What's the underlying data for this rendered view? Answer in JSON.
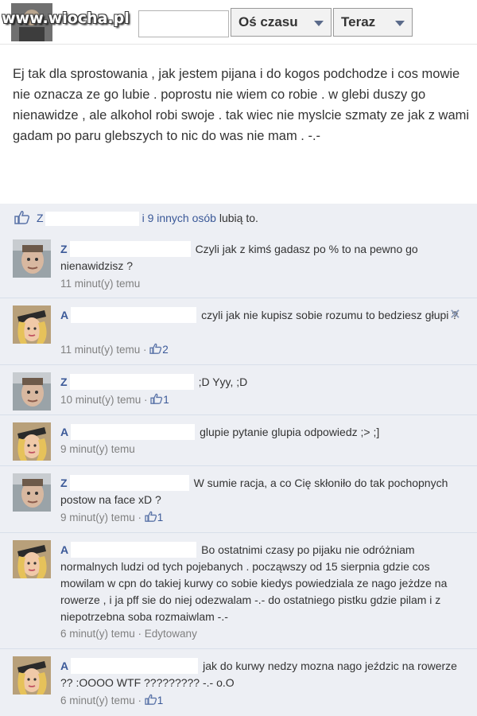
{
  "watermark": "www.wiocha.pl",
  "header": {
    "filter1": "Oś czasu",
    "filter2": "Teraz"
  },
  "post": {
    "text": "Ej tak dla sprostowania , jak jestem pijana i do kogos podchodze i cos mowie nie oznacza ze go lubie . poprostu nie wiem co robie . w glebi duszy go nienawidze , ale alkohol robi swoje . tak wiec nie myslcie szmaty ze jak z wami gadam po paru glebszych to nic do was nie mam . -.-"
  },
  "likes": {
    "first_initial": "Z",
    "others": "i 9 innych osób",
    "suffix": "lubią to."
  },
  "comments": [
    {
      "author": "Z",
      "text": "Czyli jak z kimś gadasz po % to na pewno go nienawidzisz ?",
      "time": "11 minut(y) temu",
      "likes": ""
    },
    {
      "author": "A",
      "text": "czyli jak nie kupisz sobie rozumu to bedziesz głupi ?",
      "time": "11 minut(y) temu",
      "likes": "2"
    },
    {
      "author": "Z",
      "text": ";D Yyy, ;D",
      "time": "10 minut(y) temu",
      "likes": "1"
    },
    {
      "author": "A",
      "text": "glupie pytanie glupia odpowiedz ;> ;]",
      "time": "9 minut(y) temu",
      "likes": ""
    },
    {
      "author": "Z",
      "text": "W sumie racja, a co Cię skłoniło do tak pochopnych postow na face xD ?",
      "time": "9 minut(y) temu",
      "likes": "1"
    },
    {
      "author": "A",
      "text": "Bo ostatnimi czasy po pijaku nie odróżniam normalnych ludzi od tych pojebanych . począwszy od 15 sierpnia gdzie cos mowilam w cpn do takiej kurwy co sobie kiedys powiedziala ze nago jeżdze na rowerze , i ja pff sie do niej odezwalam -.- do ostatniego pistku gdzie pilam i z niepotrzebna soba rozmaiwlam -.-",
      "time": "6 minut(y) temu",
      "likes": "",
      "edited": "Edytowany"
    },
    {
      "author": "A",
      "text": "jak do kurwy nedzy mozna nago jeździc na rowerze ?? :OOOO WTF ????????? -.- o.O",
      "time": "6 minut(y) temu",
      "likes": "1"
    }
  ],
  "colors": {
    "link": "#3b5998",
    "comment_bg": "#edeff4",
    "meta": "#808080"
  }
}
